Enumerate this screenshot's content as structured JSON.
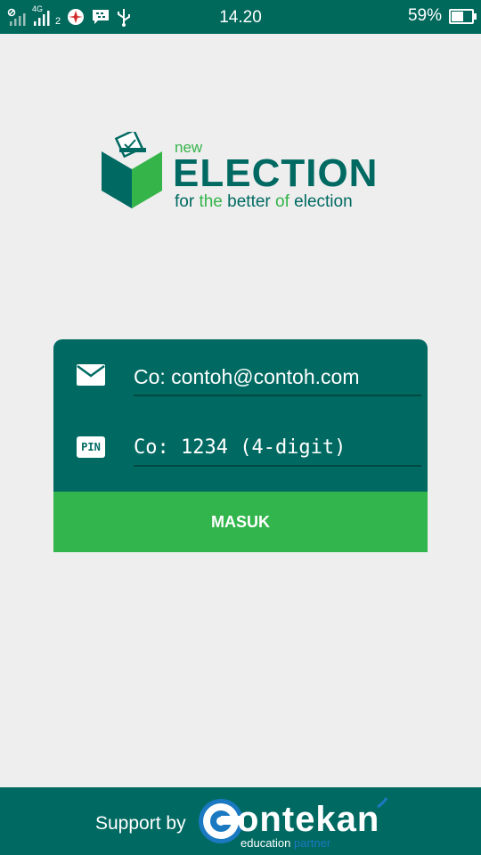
{
  "status_bar": {
    "network_label": "4G",
    "sim_number": "2",
    "time": "14.20",
    "battery_percent": "59%",
    "battery_level": 0.59
  },
  "logo": {
    "new_label": "new",
    "title": "ELECTION",
    "tagline_parts": [
      "for ",
      "the",
      " better ",
      "of",
      " election"
    ]
  },
  "login": {
    "email_placeholder": "Co: contoh@contoh.com",
    "pin_placeholder": "Co: 1234 (4-digit)",
    "pin_icon_label": "PIN",
    "submit_label": "MASUK"
  },
  "footer": {
    "support_label": "Support by",
    "brand_name": "ontekan",
    "brand_sub_1": "education",
    "brand_sub_2": "partner"
  },
  "colors": {
    "primary": "#006a62",
    "accent": "#33b54d",
    "background": "#eeeeee"
  }
}
